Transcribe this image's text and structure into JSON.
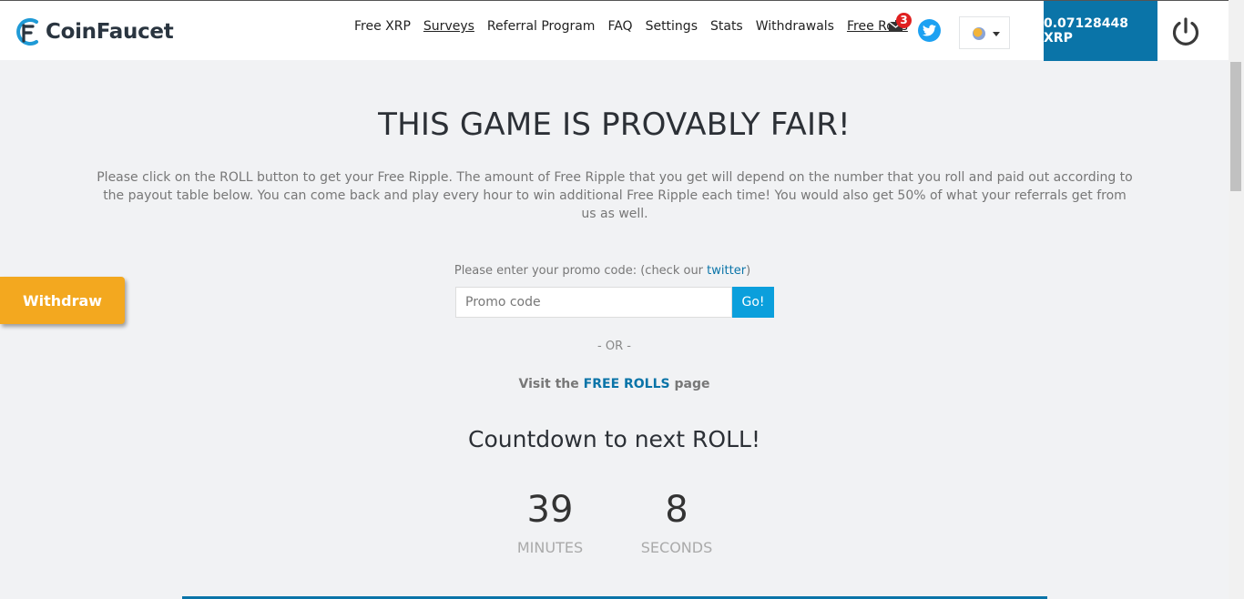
{
  "header": {
    "logo_text": "CoinFaucet",
    "nav": [
      {
        "label": "Free XRP",
        "underlined": false
      },
      {
        "label": "Surveys",
        "underlined": true
      },
      {
        "label": "Referral Program",
        "underlined": false
      },
      {
        "label": "FAQ",
        "underlined": false
      },
      {
        "label": "Settings",
        "underlined": false
      },
      {
        "label": "Stats",
        "underlined": false
      },
      {
        "label": "Withdrawals",
        "underlined": false
      },
      {
        "label": "Free Rolls",
        "underlined": true
      }
    ],
    "mail_count": "3",
    "balance": "0.07128448 XRP"
  },
  "main": {
    "title": "THIS GAME IS PROVABLY FAIR!",
    "intro": "Please click on the ROLL button to get your Free Ripple. The amount of Free Ripple that you get will depend on the number that you roll and paid out according to the payout table below. You can come back and play every hour to win additional Free Ripple each time! You would also get 50% of what your referrals get from us as well.",
    "withdraw_label": "Withdraw",
    "promo": {
      "label_before": "Please enter your promo code: (check our ",
      "label_link": "twitter",
      "label_after": ")",
      "placeholder": "Promo code",
      "go_label": "Go!"
    },
    "or_text": "- OR -",
    "visit": {
      "before": "Visit the ",
      "link": "FREE ROLLS",
      "after": " page"
    },
    "countdown": {
      "title": "Countdown to next ROLL!",
      "minutes": "39",
      "minutes_label": "MINUTES",
      "seconds": "8",
      "seconds_label": "SECONDS"
    }
  },
  "colors": {
    "accent": "#0a74a8",
    "withdraw": "#f3a81f",
    "go_button": "#0b9fdc",
    "badge": "#e02020"
  },
  "icons": [
    "coinfaucet-logo-icon",
    "mail-icon",
    "twitter-icon",
    "language-flag-icon",
    "power-icon"
  ]
}
